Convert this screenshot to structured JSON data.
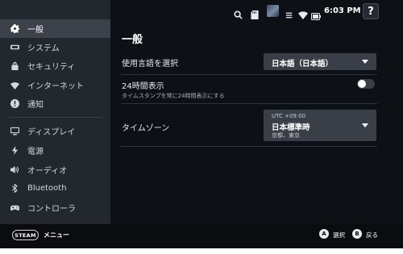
{
  "status_bar": {
    "icons": [
      "search-icon",
      "storage-icon",
      "avatar",
      "sound-icon",
      "wifi-icon",
      "battery-icon"
    ],
    "time": "6:03 PM",
    "help_label": "?"
  },
  "sidebar": {
    "items": [
      {
        "label": "一般",
        "icon": "gear-icon",
        "active": true
      },
      {
        "label": "システム",
        "icon": "system-icon",
        "active": false
      },
      {
        "label": "セキュリティ",
        "icon": "lock-icon",
        "active": false
      },
      {
        "label": "インターネット",
        "icon": "wifi-icon",
        "active": false
      },
      {
        "label": "通知",
        "icon": "alert-icon",
        "active": false
      },
      {
        "label": "ディスプレイ",
        "icon": "monitor-icon",
        "active": false
      },
      {
        "label": "電源",
        "icon": "bolt-icon",
        "active": false
      },
      {
        "label": "オーディオ",
        "icon": "speaker-icon",
        "active": false
      },
      {
        "label": "Bluetooth",
        "icon": "bluetooth-icon",
        "active": false
      },
      {
        "label": "コントローラ",
        "icon": "gamepad-icon",
        "active": false
      }
    ]
  },
  "main": {
    "title": "一般",
    "language": {
      "label": "使用言語を選択",
      "value": "日本語（日本語）"
    },
    "clock24": {
      "label": "24時間表示",
      "description": "タイムスタンプを常に24時間表示にする",
      "enabled": false
    },
    "timezone": {
      "label": "タイムゾーン",
      "offset": "UTC +09:00",
      "value": "日本標準時",
      "cities": "京都、東京"
    }
  },
  "bottom_bar": {
    "steam_label": "STEAM",
    "menu_label": "メニュー",
    "a_key": "A",
    "a_label": "選択",
    "b_key": "B",
    "b_label": "戻る"
  },
  "colors": {
    "sidebar_bg": "#23272e",
    "sidebar_active": "#3c414a",
    "dropdown_bg": "#3a3f47",
    "background": "#0d1015"
  }
}
